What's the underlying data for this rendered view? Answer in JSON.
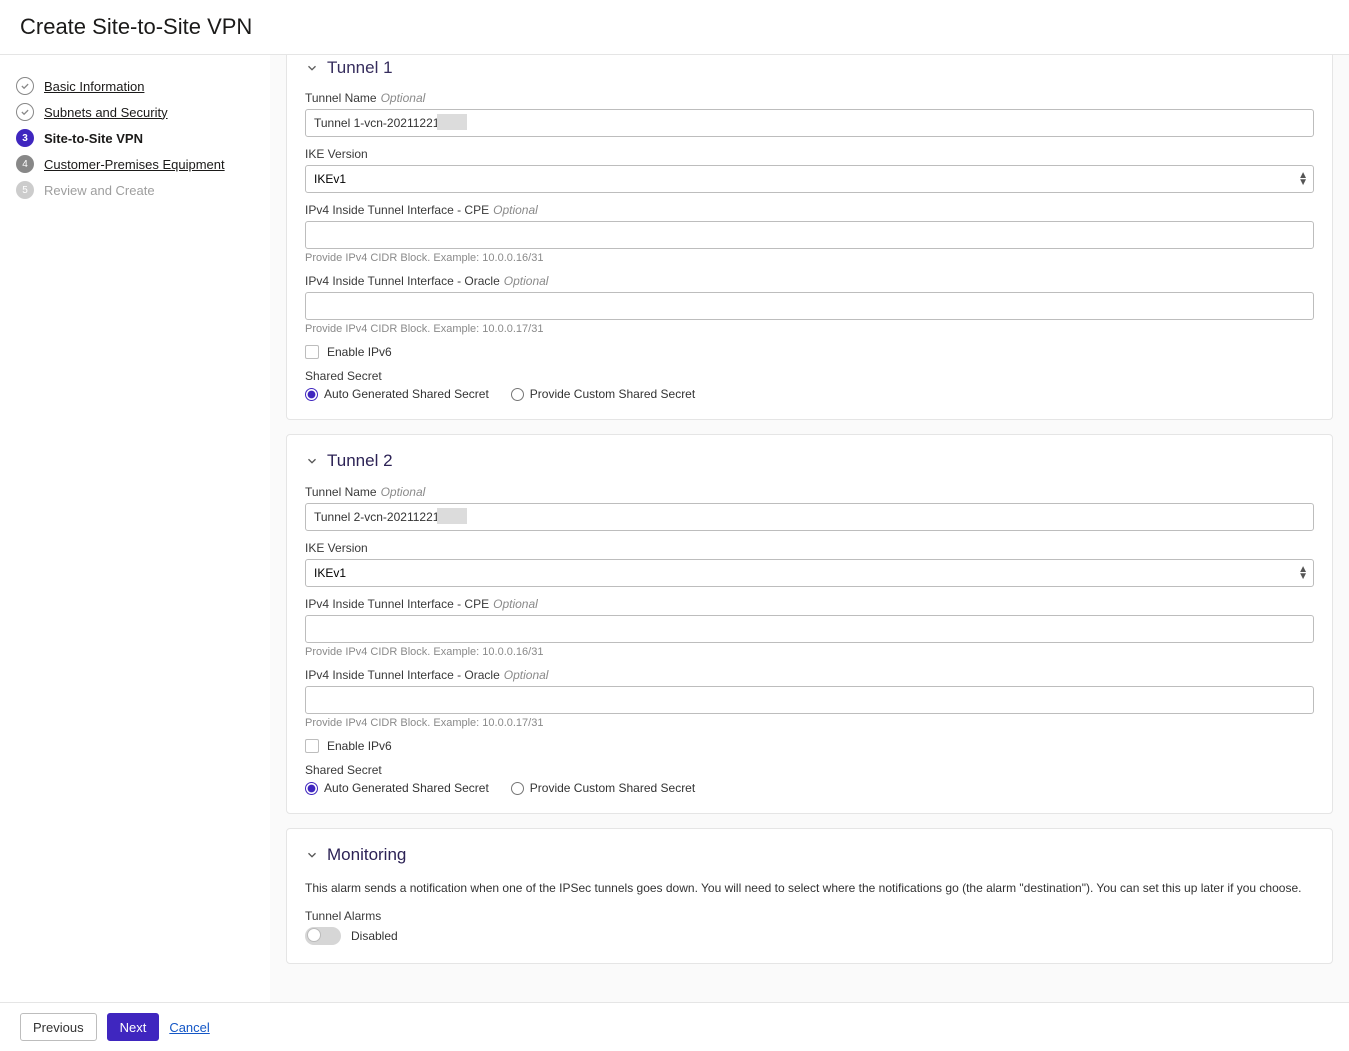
{
  "page_title": "Create Site-to-Site VPN",
  "steps": [
    {
      "label": "Basic Information",
      "state": "done"
    },
    {
      "label": "Subnets and Security",
      "state": "done"
    },
    {
      "label": "Site-to-Site VPN",
      "state": "active",
      "num": "3"
    },
    {
      "label": "Customer-Premises Equipment",
      "state": "inactive",
      "num": "4"
    },
    {
      "label": "Review and Create",
      "state": "future",
      "num": "5"
    }
  ],
  "tunnel1": {
    "heading": "Tunnel 1",
    "name_label": "Tunnel Name",
    "name_optional": "Optional",
    "name_value": "Tunnel 1-vcn-20211221-",
    "ike_label": "IKE Version",
    "ike_value": "IKEv1",
    "cpe_label": "IPv4 Inside Tunnel Interface - CPE",
    "cpe_optional": "Optional",
    "cpe_help": "Provide IPv4 CIDR Block. Example: 10.0.0.16/31",
    "oracle_label": "IPv4 Inside Tunnel Interface - Oracle",
    "oracle_optional": "Optional",
    "oracle_help": "Provide IPv4 CIDR Block. Example: 10.0.0.17/31",
    "ipv6_label": "Enable IPv6",
    "shared_secret_label": "Shared Secret",
    "radio_auto": "Auto Generated Shared Secret",
    "radio_custom": "Provide Custom Shared Secret"
  },
  "tunnel2": {
    "heading": "Tunnel 2",
    "name_label": "Tunnel Name",
    "name_optional": "Optional",
    "name_value": "Tunnel 2-vcn-20211221-",
    "ike_label": "IKE Version",
    "ike_value": "IKEv1",
    "cpe_label": "IPv4 Inside Tunnel Interface - CPE",
    "cpe_optional": "Optional",
    "cpe_help": "Provide IPv4 CIDR Block. Example: 10.0.0.16/31",
    "oracle_label": "IPv4 Inside Tunnel Interface - Oracle",
    "oracle_optional": "Optional",
    "oracle_help": "Provide IPv4 CIDR Block. Example: 10.0.0.17/31",
    "ipv6_label": "Enable IPv6",
    "shared_secret_label": "Shared Secret",
    "radio_auto": "Auto Generated Shared Secret",
    "radio_custom": "Provide Custom Shared Secret"
  },
  "monitoring": {
    "heading": "Monitoring",
    "description": "This alarm sends a notification when one of the IPSec tunnels goes down. You will need to select where the notifications go (the alarm \"destination\"). You can set this up later if you choose.",
    "alarms_label": "Tunnel Alarms",
    "toggle_state": "Disabled"
  },
  "footer": {
    "previous": "Previous",
    "next": "Next",
    "cancel": "Cancel"
  }
}
